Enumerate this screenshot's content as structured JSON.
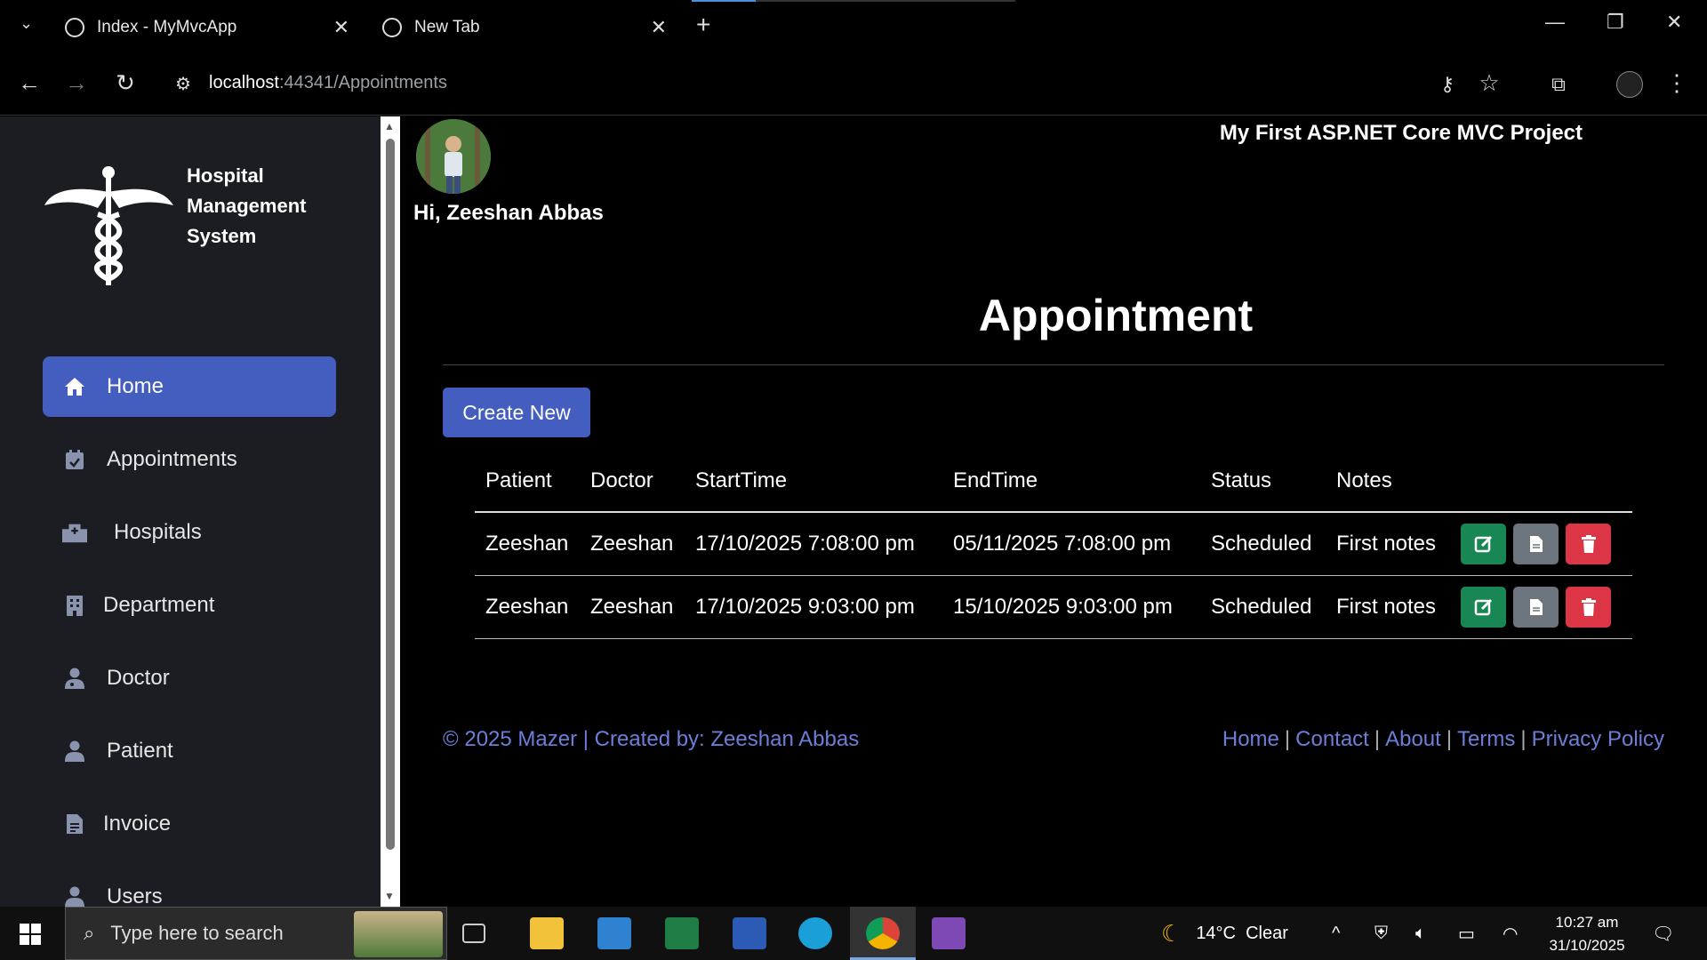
{
  "browser": {
    "tabs": [
      {
        "label": "Index - MyMvcApp"
      },
      {
        "label": "New Tab"
      }
    ],
    "url_host": "localhost",
    "url_rest": ":44341/Appointments"
  },
  "sidebar": {
    "logo_text": "Hospital Management System",
    "items": [
      {
        "label": "Home",
        "icon": "home-icon"
      },
      {
        "label": "Appointments",
        "icon": "calendar-check-icon"
      },
      {
        "label": "Hospitals",
        "icon": "hospital-icon"
      },
      {
        "label": "Department",
        "icon": "building-icon"
      },
      {
        "label": "Doctor",
        "icon": "user-doctor-icon"
      },
      {
        "label": "Patient",
        "icon": "user-icon"
      },
      {
        "label": "Invoice",
        "icon": "file-invoice-icon"
      },
      {
        "label": "Users",
        "icon": "users-icon"
      }
    ]
  },
  "header": {
    "greeting": "Hi, Zeeshan Abbas",
    "project_title": "My First ASP.NET Core MVC Project"
  },
  "main": {
    "title": "Appointment",
    "create_label": "Create New",
    "columns": [
      "Patient",
      "Doctor",
      "StartTime",
      "EndTime",
      "Status",
      "Notes"
    ],
    "rows": [
      {
        "patient": "Zeeshan",
        "doctor": "Zeeshan",
        "start": "17/10/2025 7:08:00 pm",
        "end": "05/11/2025 7:08:00 pm",
        "status": "Scheduled",
        "notes": "First notes"
      },
      {
        "patient": "Zeeshan",
        "doctor": "Zeeshan",
        "start": "17/10/2025 9:03:00 pm",
        "end": "15/10/2025 9:03:00 pm",
        "status": "Scheduled",
        "notes": "First notes"
      }
    ]
  },
  "footer": {
    "left": "© 2025 Mazer | Created by: Zeeshan Abbas",
    "links": [
      "Home",
      "Contact",
      "About",
      "Terms",
      "Privacy Policy"
    ]
  },
  "taskbar": {
    "search_placeholder": "Type here to search",
    "weather": "14°C  Clear",
    "time": "10:27 am",
    "date": "31/10/2025"
  },
  "colors": {
    "primary": "#435ebe",
    "edit": "#198754",
    "details": "#6c757d",
    "delete": "#dc3545",
    "link": "#6c7fd8"
  }
}
